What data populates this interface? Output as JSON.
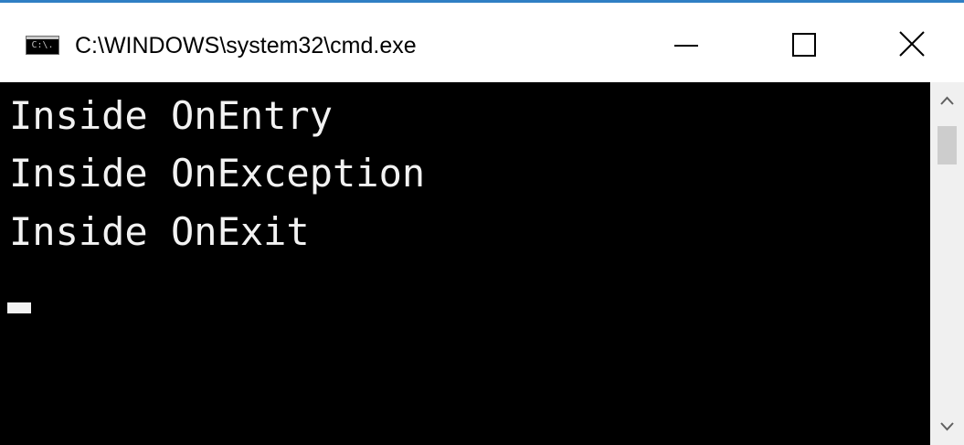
{
  "window": {
    "title": "C:\\WINDOWS\\system32\\cmd.exe",
    "icon": "cmd-icon",
    "icon_text": "C:\\.",
    "accent_color": "#2f7fc4",
    "caption_buttons": {
      "minimize_icon": "minimize-icon",
      "maximize_icon": "maximize-icon",
      "close_icon": "close-icon"
    }
  },
  "console": {
    "background": "#000000",
    "foreground": "#f2f2f2",
    "lines": [
      "Inside OnEntry",
      "Inside OnException",
      "Inside OnExit"
    ],
    "cursor": "block-cursor"
  },
  "scrollbar": {
    "up_icon": "chevron-up-icon",
    "down_icon": "chevron-down-icon"
  }
}
